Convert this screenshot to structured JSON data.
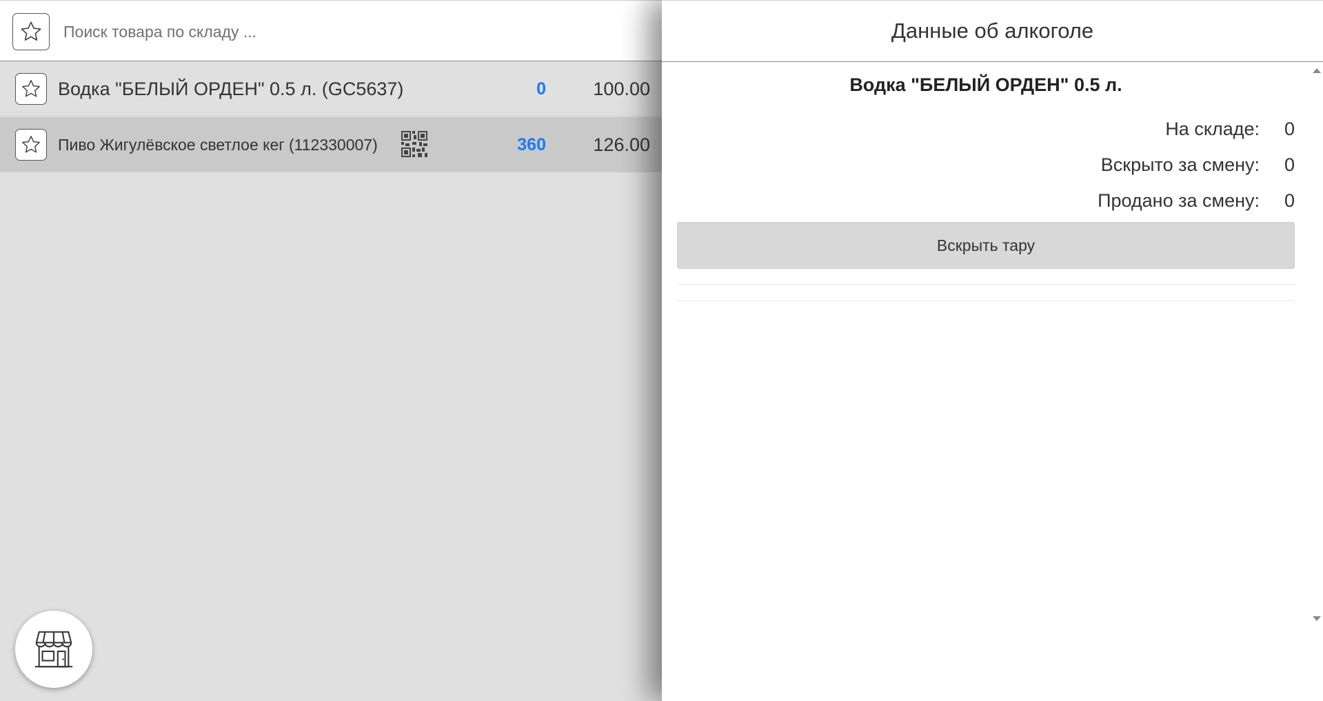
{
  "search": {
    "placeholder": "Поиск товара по складу ..."
  },
  "products": [
    {
      "name": "Водка \"БЕЛЫЙ ОРДЕН\" 0.5 л. (GC5637)",
      "qty": "0",
      "price": "100.00",
      "has_qr": false
    },
    {
      "name": "Пиво Жигулёвское светлое кег (112330007)",
      "qty": "360",
      "price": "126.00",
      "has_qr": true
    }
  ],
  "detail": {
    "header": "Данные об алкоголе",
    "product_name": "Водка \"БЕЛЫЙ ОРДЕН\" 0.5 л.",
    "stats": [
      {
        "label": "На складе:",
        "value": "0"
      },
      {
        "label": "Вскрыто за смену:",
        "value": "0"
      },
      {
        "label": "Продано за смену:",
        "value": "0"
      }
    ],
    "open_button": "Вскрыть тару"
  },
  "icons": {
    "favorite": "star-icon",
    "qr": "qr-code-icon",
    "shop": "store-icon"
  },
  "colors": {
    "accent_qty": "#1a7cf0",
    "selected_row": "#c9c9c9",
    "list_background": "#e0e0e0"
  }
}
